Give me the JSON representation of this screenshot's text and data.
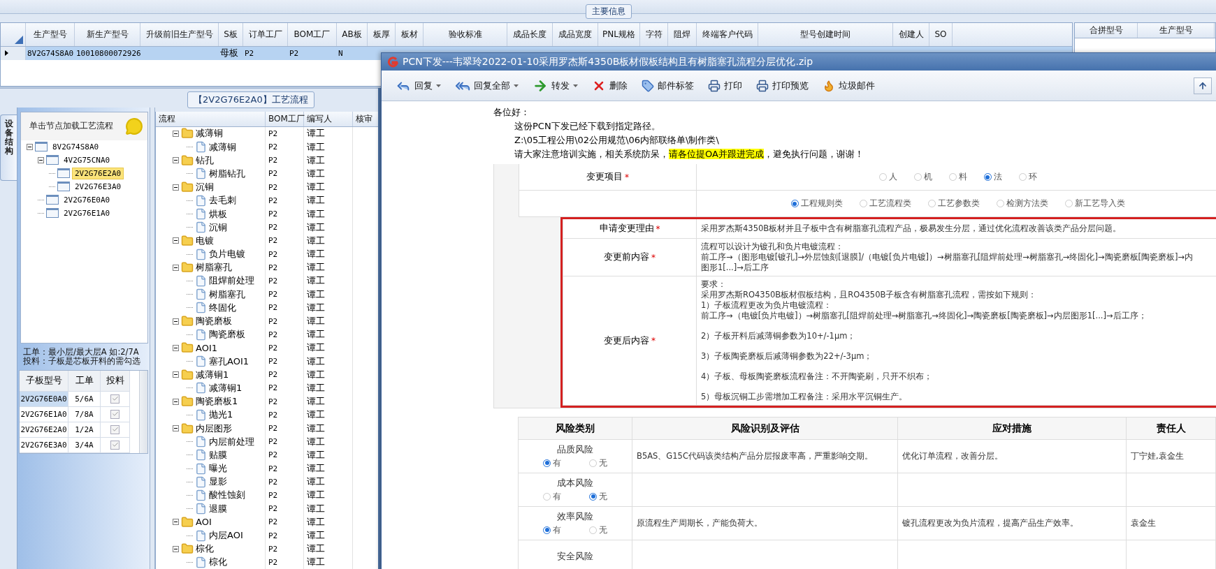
{
  "main_info": {
    "title": "主要信息",
    "columns": [
      "生产型号",
      "新生产型号",
      "升级前旧生产型号",
      "S板",
      "订单工厂",
      "BOM工厂",
      "AB板",
      "板厚",
      "板材",
      "验收标准",
      "成品长度",
      "成品宽度",
      "PNL规格",
      "字符",
      "阻焊",
      "终端客户代码",
      "型号创建时间",
      "创建人",
      "SO"
    ],
    "rows": [
      {
        "selected": true,
        "cells": [
          "8V2G74S8A0",
          "10010800072926",
          null,
          "母板",
          "P2",
          "P2",
          "N"
        ]
      }
    ]
  },
  "merge_grid": {
    "columns": [
      "合拼型号",
      "生产型号"
    ]
  },
  "process": {
    "title": "【2V2G76E2A0】工艺流程",
    "side_tab": "设备结构",
    "tree_hint": "单击节点加载工艺流程",
    "tree": [
      {
        "label": "8V2G74S8A0",
        "expanded": true,
        "selected": false,
        "children": [
          {
            "label": "4V2G75CNA0",
            "expanded": true,
            "selected": false,
            "children": [
              {
                "label": "2V2G76E2A0",
                "selected": true
              },
              {
                "label": "2V2G76E3A0",
                "selected": false
              }
            ]
          },
          {
            "label": "2V2G76E0A0",
            "selected": false
          },
          {
            "label": "2V2G76E1A0",
            "selected": false
          }
        ]
      }
    ],
    "notes": [
      "工单：最小层/最大层A 如:2/7A",
      "投料：子板是芯板开料的需勾选"
    ],
    "board_grid": {
      "columns": [
        "子板型号",
        "工单",
        "投料"
      ],
      "rows": [
        {
          "model": "2V2G76E0A0",
          "order": "5/6A",
          "feed": true,
          "selected": true
        },
        {
          "model": "2V2G76E1A0",
          "order": "7/8A",
          "feed": true,
          "selected": false
        },
        {
          "model": "2V2G76E2A0",
          "order": "1/2A",
          "feed": true,
          "selected": false
        },
        {
          "model": "2V2G76E3A0",
          "order": "3/4A",
          "feed": true,
          "selected": false
        }
      ]
    },
    "flow_grid": {
      "columns": [
        "流程",
        "BOM工厂",
        "编写人",
        "核审"
      ],
      "steps": [
        {
          "label": "减薄铜",
          "factory": "P2",
          "writer": "谭工",
          "expanded": true,
          "children": [
            {
              "label": "减薄铜",
              "factory": "P2",
              "writer": "谭工"
            }
          ]
        },
        {
          "label": "钻孔",
          "factory": "P2",
          "writer": "谭工",
          "expanded": true,
          "children": [
            {
              "label": "树脂钻孔",
              "factory": "P2",
              "writer": "谭工"
            }
          ]
        },
        {
          "label": "沉铜",
          "factory": "P2",
          "writer": "谭工",
          "expanded": true,
          "children": [
            {
              "label": "去毛刺",
              "factory": "P2",
              "writer": "谭工"
            },
            {
              "label": "烘板",
              "factory": "P2",
              "writer": "谭工"
            },
            {
              "label": "沉铜",
              "factory": "P2",
              "writer": "谭工"
            }
          ]
        },
        {
          "label": "电镀",
          "factory": "P2",
          "writer": "谭工",
          "expanded": true,
          "children": [
            {
              "label": "负片电镀",
              "factory": "P2",
              "writer": "谭工"
            }
          ]
        },
        {
          "label": "树脂塞孔",
          "factory": "P2",
          "writer": "谭工",
          "expanded": true,
          "children": [
            {
              "label": "阻焊前处理",
              "factory": "P2",
              "writer": "谭工"
            },
            {
              "label": "树脂塞孔",
              "factory": "P2",
              "writer": "谭工"
            },
            {
              "label": "终固化",
              "factory": "P2",
              "writer": "谭工"
            }
          ]
        },
        {
          "label": "陶瓷磨板",
          "factory": "P2",
          "writer": "谭工",
          "expanded": true,
          "children": [
            {
              "label": "陶瓷磨板",
              "factory": "P2",
              "writer": "谭工"
            }
          ]
        },
        {
          "label": "AOI1",
          "factory": "P2",
          "writer": "谭工",
          "expanded": true,
          "children": [
            {
              "label": "塞孔AOI1",
              "factory": "P2",
              "writer": "谭工"
            }
          ]
        },
        {
          "label": "减薄铜1",
          "factory": "P2",
          "writer": "谭工",
          "expanded": true,
          "children": [
            {
              "label": "减薄铜1",
              "factory": "P2",
              "writer": "谭工"
            }
          ]
        },
        {
          "label": "陶瓷磨板1",
          "factory": "P2",
          "writer": "谭工",
          "expanded": true,
          "children": [
            {
              "label": "抛光1",
              "factory": "P2",
              "writer": "谭工"
            }
          ]
        },
        {
          "label": "内层图形",
          "factory": "P2",
          "writer": "谭工",
          "expanded": true,
          "children": [
            {
              "label": "内层前处理",
              "factory": "P2",
              "writer": "谭工"
            },
            {
              "label": "贴膜",
              "factory": "P2",
              "writer": "谭工"
            },
            {
              "label": "曝光",
              "factory": "P2",
              "writer": "谭工"
            },
            {
              "label": "显影",
              "factory": "P2",
              "writer": "谭工"
            },
            {
              "label": "酸性蚀刻",
              "factory": "P2",
              "writer": "谭工"
            },
            {
              "label": "退膜",
              "factory": "P2",
              "writer": "谭工"
            }
          ]
        },
        {
          "label": "AOI",
          "factory": "P2",
          "writer": "谭工",
          "expanded": true,
          "children": [
            {
              "label": "内层AOI",
              "factory": "P2",
              "writer": "谭工"
            }
          ]
        },
        {
          "label": "棕化",
          "factory": "P2",
          "writer": "谭工",
          "expanded": true,
          "children": [
            {
              "label": "棕化",
              "factory": "P2",
              "writer": "谭工"
            }
          ]
        }
      ]
    }
  },
  "email": {
    "title": "PCN下发---韦翠玲2022-01-10采用罗杰斯4350B板材假板结构且有树脂塞孔流程分层优化.zip",
    "toolbar": [
      {
        "label": "回复",
        "dropdown": true
      },
      {
        "label": "回复全部",
        "dropdown": true
      },
      {
        "label": "转发",
        "dropdown": true
      },
      {
        "label": "删除",
        "dropdown": false
      },
      {
        "label": "邮件标签",
        "dropdown": false
      },
      {
        "label": "打印",
        "dropdown": false
      },
      {
        "label": "打印预览",
        "dropdown": false
      },
      {
        "label": "垃圾邮件",
        "dropdown": false
      }
    ],
    "greeting": "各位好：",
    "lines": [
      [
        {
          "text": "这份PCN下发已经下载到指定路径。",
          "highlight": false
        }
      ],
      [
        {
          "text": "Z:\\05工程公用\\02公用规范\\06内部联络单\\制作类\\",
          "highlight": false
        }
      ],
      [
        {
          "text": "请大家注意培训实施，相关系统防呆，",
          "highlight": false
        },
        {
          "text": "请各位提OA并跟进完成",
          "highlight": true
        },
        {
          "text": "，避免执行问题，谢谢！",
          "highlight": false
        }
      ]
    ],
    "form": [
      {
        "kind": "radios",
        "label": "变更项目",
        "mark": "*",
        "highlighted": false,
        "options": [
          {
            "label": "人",
            "selected": false
          },
          {
            "label": "机",
            "selected": false
          },
          {
            "label": "料",
            "selected": false
          },
          {
            "label": "法",
            "selected": true
          },
          {
            "label": "环",
            "selected": false
          }
        ]
      },
      {
        "kind": "radios",
        "highlighted": false,
        "options": [
          {
            "label": "工程规则类",
            "selected": true
          },
          {
            "label": "工艺流程类",
            "selected": false
          },
          {
            "label": "工艺参数类",
            "selected": false
          },
          {
            "label": "检测方法类",
            "selected": false
          },
          {
            "label": "新工艺导入类",
            "selected": false
          }
        ]
      },
      {
        "kind": "text",
        "label": "申请变更理由",
        "mark": "*",
        "highlighted": true,
        "paragraphs": [
          [
            "采用罗杰斯4350B板材并且子板中含有树脂塞孔流程产品，极易发生分层，通过优化流程改善该类产品分层问题。"
          ]
        ]
      },
      {
        "kind": "text",
        "label": "变更前内容",
        "mark": "*",
        "highlighted": true,
        "paragraphs": [
          [
            "流程可以设计为镀孔和负片电镀流程：",
            "前工序→（图形电镀[镀孔]→外层蚀刻[退膜]/（电镀[负片电镀]）→树脂塞孔[阻焊前处理→树脂塞孔→终固化]→陶瓷磨板[陶瓷磨板]→内",
            "图形1[...]→后工序"
          ]
        ]
      },
      {
        "kind": "text",
        "label": "变更后内容",
        "mark": "*",
        "highlighted": true,
        "paragraphs": [
          [
            "要求：",
            "采用罗杰斯RO4350B板材假板结构，且RO4350B子板含有树脂塞孔流程，需按如下规则：",
            "1）子板流程更改为负片电镀流程：",
            "前工序→（电镀[负片电镀]）→树脂塞孔[阻焊前处理→树脂塞孔→终固化]→陶瓷磨板[陶瓷磨板]→内层图形1[...]→后工序；"
          ],
          [
            "2）子板开料后减薄铜参数为10+/-1μm；"
          ],
          [
            "3）子板陶瓷磨板后减薄铜参数为22+/-3μm；"
          ],
          [
            "4）子板、母板陶瓷磨板流程备注：不开陶瓷刷，只开不织布；"
          ],
          [
            "5）母板沉铜工步需增加工程备注：采用水平沉铜生产。"
          ]
        ]
      }
    ],
    "risk_table": {
      "columns": [
        "风险类别",
        "风险识别及评估",
        "应对措施",
        "责任人"
      ],
      "rows": [
        {
          "category": "品质风险",
          "options": [
            {
              "label": "有",
              "selected": true
            },
            {
              "label": "无",
              "selected": false
            }
          ],
          "assessment": "B5AS、G15C代码该类结构产品分层报废率高，严重影响交期。",
          "measure": "优化订单流程，改善分层。",
          "owner": "丁宁娃,袁金生"
        },
        {
          "category": "成本风险",
          "options": [
            {
              "label": "有",
              "selected": false
            },
            {
              "label": "无",
              "selected": true
            }
          ]
        },
        {
          "category": "效率风险",
          "options": [
            {
              "label": "有",
              "selected": true
            },
            {
              "label": "无",
              "selected": false
            }
          ],
          "assessment": "原流程生产周期长，产能负荷大。",
          "measure": "镀孔流程更改为负片流程，提高产品生产效率。",
          "owner": "袁金生"
        },
        {
          "category": "安全风险"
        }
      ]
    }
  }
}
